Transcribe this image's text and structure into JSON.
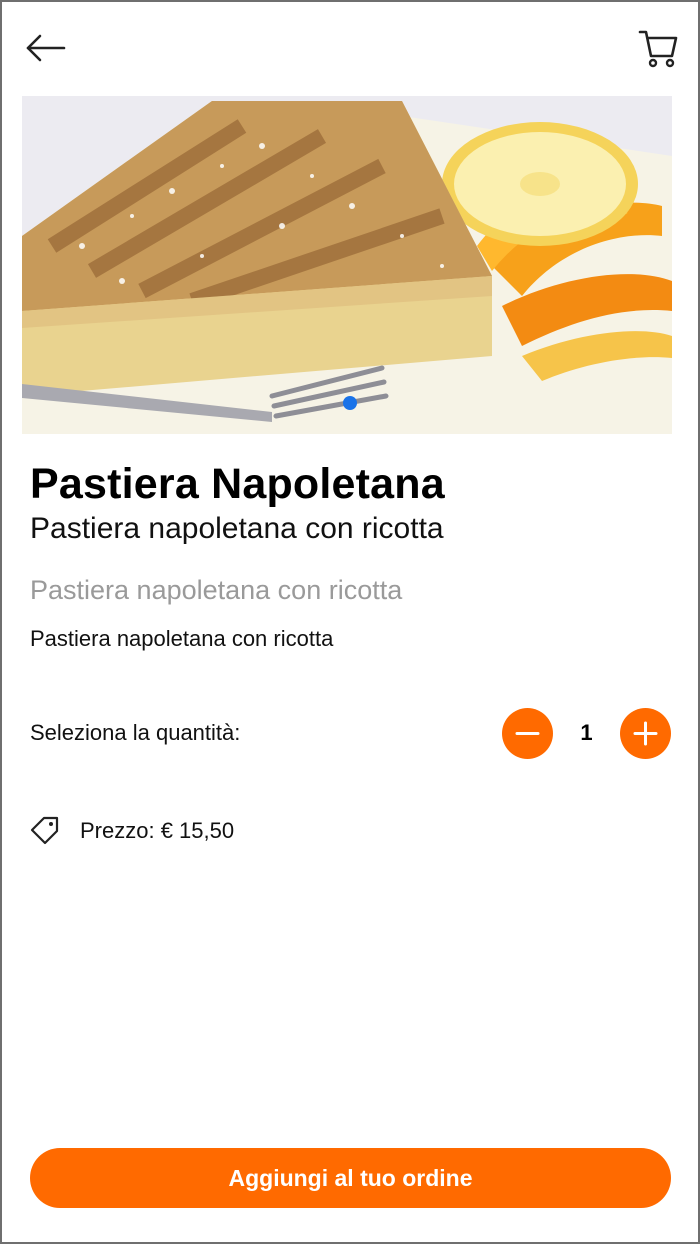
{
  "header": {
    "back_icon": "arrow-left-icon",
    "cart_icon": "cart-icon"
  },
  "product": {
    "image_alt": "Pastiera Napoletana",
    "title": "Pastiera Napoletana",
    "subtitle": "Pastiera napoletana con ricotta",
    "short_description": "Pastiera napoletana con ricotta",
    "description": "Pastiera napoletana con ricotta"
  },
  "quantity": {
    "label": "Seleziona la quantità:",
    "value": "1",
    "minus_icon": "minus-icon",
    "plus_icon": "plus-icon"
  },
  "price": {
    "icon": "tag-icon",
    "text": "Prezzo: € 15,50"
  },
  "cta": {
    "label": "Aggiungi al tuo ordine"
  },
  "colors": {
    "accent": "#ff6a00",
    "carousel_dot": "#1a73e8"
  }
}
